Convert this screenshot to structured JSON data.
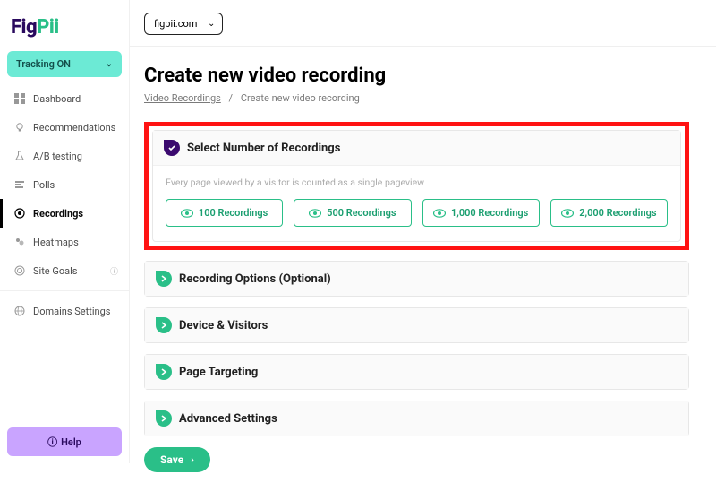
{
  "brand": {
    "part1": "Fig",
    "part2": "Pii"
  },
  "sidebar": {
    "tracking": {
      "label": "Tracking ON"
    },
    "items": [
      {
        "label": "Dashboard",
        "icon": "dashboard-icon"
      },
      {
        "label": "Recommendations",
        "icon": "bulb-icon"
      },
      {
        "label": "A/B testing",
        "icon": "flask-icon"
      },
      {
        "label": "Polls",
        "icon": "polls-icon"
      },
      {
        "label": "Recordings",
        "icon": "rec-icon",
        "active": true
      },
      {
        "label": "Heatmaps",
        "icon": "heatmap-icon"
      },
      {
        "label": "Site Goals",
        "icon": "target-icon",
        "badge": "ⓘ"
      },
      {
        "label": "Domains Settings",
        "icon": "globe-icon"
      }
    ],
    "help": "Help"
  },
  "domain_select": {
    "value": "figpii.com"
  },
  "page": {
    "title": "Create new video recording",
    "breadcrumb": {
      "root": "Video Recordings",
      "current": "Create new video recording"
    }
  },
  "section1": {
    "title": "Select Number of Recordings",
    "hint": "Every page viewed by a visitor is counted as a single pageview",
    "options": [
      "100 Recordings",
      "500 Recordings",
      "1,000 Recordings",
      "2,000 Recordings"
    ]
  },
  "collapsed": {
    "recording_options": "Recording Options (Optional)",
    "device_visitors": "Device & Visitors",
    "page_targeting": "Page Targeting",
    "advanced": "Advanced Settings"
  },
  "save_label": "Save"
}
